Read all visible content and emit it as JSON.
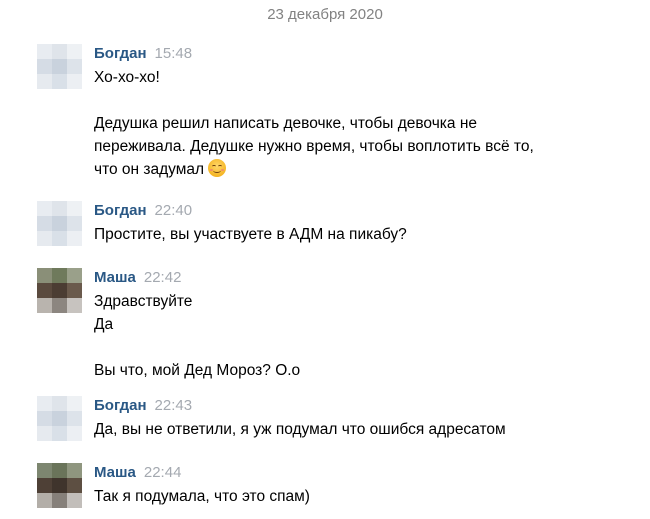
{
  "date": "23 декабря 2020",
  "messages": [
    {
      "name": "Богдан",
      "time": "15:48",
      "lines": [
        "Хо-хо-хо!",
        "",
        "Дедушка решил написать девочке, чтобы девочка не",
        "переживала. Дедушке нужно время, чтобы воплотить всё то,",
        "что он задумал"
      ],
      "emoji": "smiling-face-emoji"
    },
    {
      "name": "Богдан",
      "time": "22:40",
      "lines": [
        "Простите, вы участвуете в АДМ на пикабу?"
      ]
    },
    {
      "name": "Маша",
      "time": "22:42",
      "lines": [
        "Здравствуйте",
        "Да",
        "",
        "Вы что, мой Дед Мороз? О.о"
      ]
    },
    {
      "name": "Богдан",
      "time": "22:43",
      "lines": [
        "Да, вы не ответили, я уж подумал что ошибся адресатом"
      ]
    },
    {
      "name": "Маша",
      "time": "22:44",
      "lines": [
        "Так я подумала, что это спам)"
      ]
    }
  ],
  "colors": {
    "name": "#2a5885",
    "time": "#a4a9b0",
    "date": "#828282"
  }
}
